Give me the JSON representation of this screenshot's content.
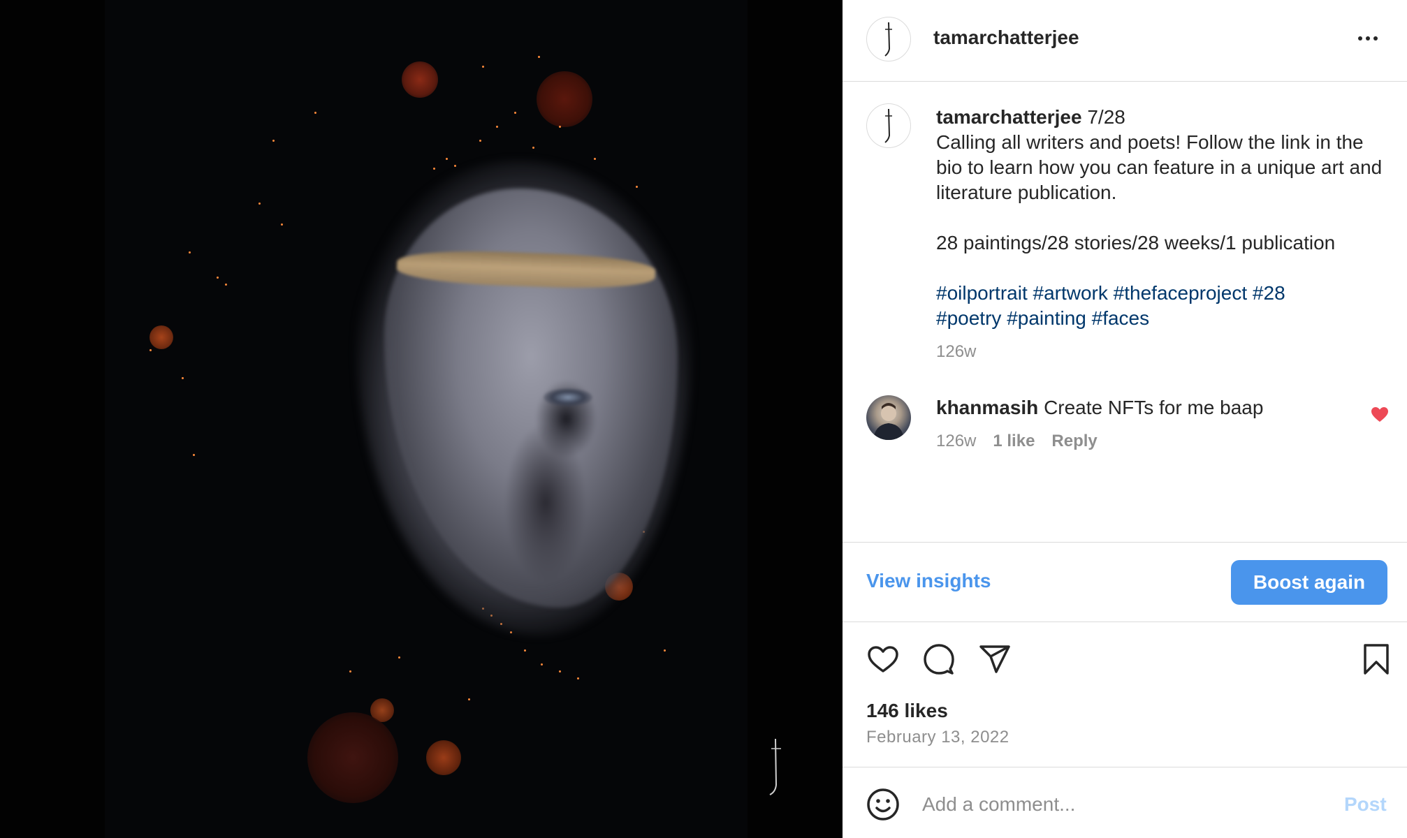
{
  "post": {
    "header_username": "tamarchatterjee",
    "caption": {
      "username": "tamarchatterjee",
      "title": "7/28",
      "line1": "Calling all writers and poets! Follow the link in the bio to learn how you can feature in a unique art and literature publication.",
      "line2": "28 paintings/28 stories/28 weeks/1 publication",
      "hashtags": [
        "#oilportrait",
        "#artwork",
        "#thefaceproject",
        "#28",
        "#poetry",
        "#painting",
        "#faces"
      ],
      "time": "126w"
    },
    "comment": {
      "username": "khanmasih",
      "text": "Create NFTs for me baap",
      "time": "126w",
      "likes": "1 like",
      "reply": "Reply",
      "liked": true
    },
    "insights_label": "View insights",
    "boost_label": "Boost again",
    "actions": {
      "like_icon": "heart-outline",
      "comment_icon": "speech-bubble",
      "share_icon": "paper-plane",
      "save_icon": "bookmark"
    },
    "likes": "146 likes",
    "date": "February 13, 2022",
    "add_comment": {
      "placeholder": "Add a comment...",
      "post_label": "Post"
    }
  },
  "colors": {
    "accent": "#4a95ec",
    "hashtag": "#00376b",
    "heart": "#ed4956",
    "muted": "#8e8e8e"
  }
}
